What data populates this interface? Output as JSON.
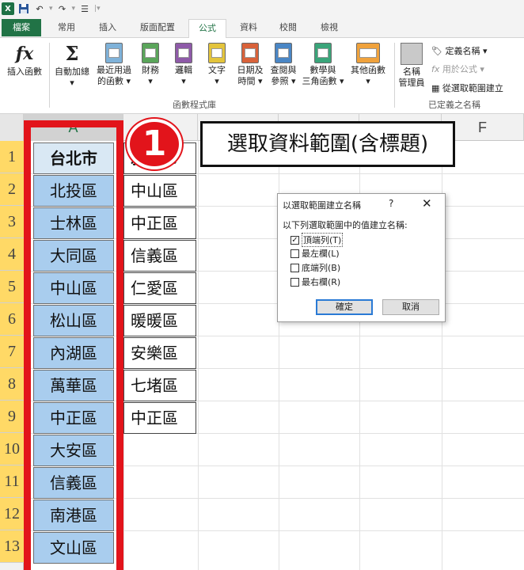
{
  "quick_access": {
    "excel_icon": "X",
    "save_icon": "floppy-disk",
    "undo_icon": "↶",
    "redo_icon": "↷",
    "format_icon": "☰"
  },
  "tabs": [
    "檔案",
    "常用",
    "插入",
    "版面配置",
    "公式",
    "資料",
    "校閱",
    "檢視"
  ],
  "active_tab": "公式",
  "ribbon": {
    "insert_function": {
      "icon": "fx",
      "label": "插入函數"
    },
    "function_library": {
      "autosum": {
        "icon": "Σ",
        "line1": "自動加總",
        "line2": "▾"
      },
      "recently_used": {
        "line1": "最近用過",
        "line2": "的函數 ▾"
      },
      "financial": {
        "line1": "財務",
        "line2": "▾"
      },
      "logical": {
        "line1": "邏輯",
        "line2": "▾"
      },
      "text": {
        "line1": "文字",
        "line2": "▾"
      },
      "date_time": {
        "line1": "日期及",
        "line2": "時間 ▾"
      },
      "lookup_reference": {
        "line1": "查閱與",
        "line2": "參照 ▾"
      },
      "math_trig": {
        "line1": "數學與",
        "line2": "三角函數 ▾"
      },
      "more_functions": {
        "line1": "其他函數",
        "line2": "▾"
      },
      "group_label": "函數程式庫"
    },
    "defined_names": {
      "name_manager": {
        "line1": "名稱",
        "line2": "管理員"
      },
      "define_name": "定義名稱 ▾",
      "use_in_formula": "用於公式 ▾",
      "create_from_selection": "從選取範圍建立",
      "group_label": "已定義之名稱"
    }
  },
  "sheet": {
    "columns": [
      "A",
      "F"
    ],
    "rows": [
      "1",
      "2",
      "3",
      "4",
      "5",
      "6",
      "7",
      "8",
      "9",
      "10",
      "11",
      "12",
      "13"
    ],
    "column_a": [
      "台北市",
      "北投區",
      "士林區",
      "大同區",
      "中山區",
      "松山區",
      "內湖區",
      "萬華區",
      "中正區",
      "大安區",
      "信義區",
      "南港區",
      "文山區"
    ],
    "column_b": [
      "新北市",
      "中山區",
      "中正區",
      "信義區",
      "仁愛區",
      "暖暖區",
      "安樂區",
      "七堵區",
      "中正區"
    ]
  },
  "annotation": {
    "badge": "1",
    "callout": "選取資料範圍(含標題)",
    "highlight_color": "#e2141b"
  },
  "dialog": {
    "title": "以選取範圍建立名稱",
    "help": "?",
    "close": "✕",
    "prompt": "以下列選取範圍中的值建立名稱:",
    "options": [
      {
        "label": "頂端列(T)",
        "checked": true
      },
      {
        "label": "最左欄(L)",
        "checked": false
      },
      {
        "label": "底端列(B)",
        "checked": false
      },
      {
        "label": "最右欄(R)",
        "checked": false
      }
    ],
    "ok": "確定",
    "cancel": "取消"
  }
}
